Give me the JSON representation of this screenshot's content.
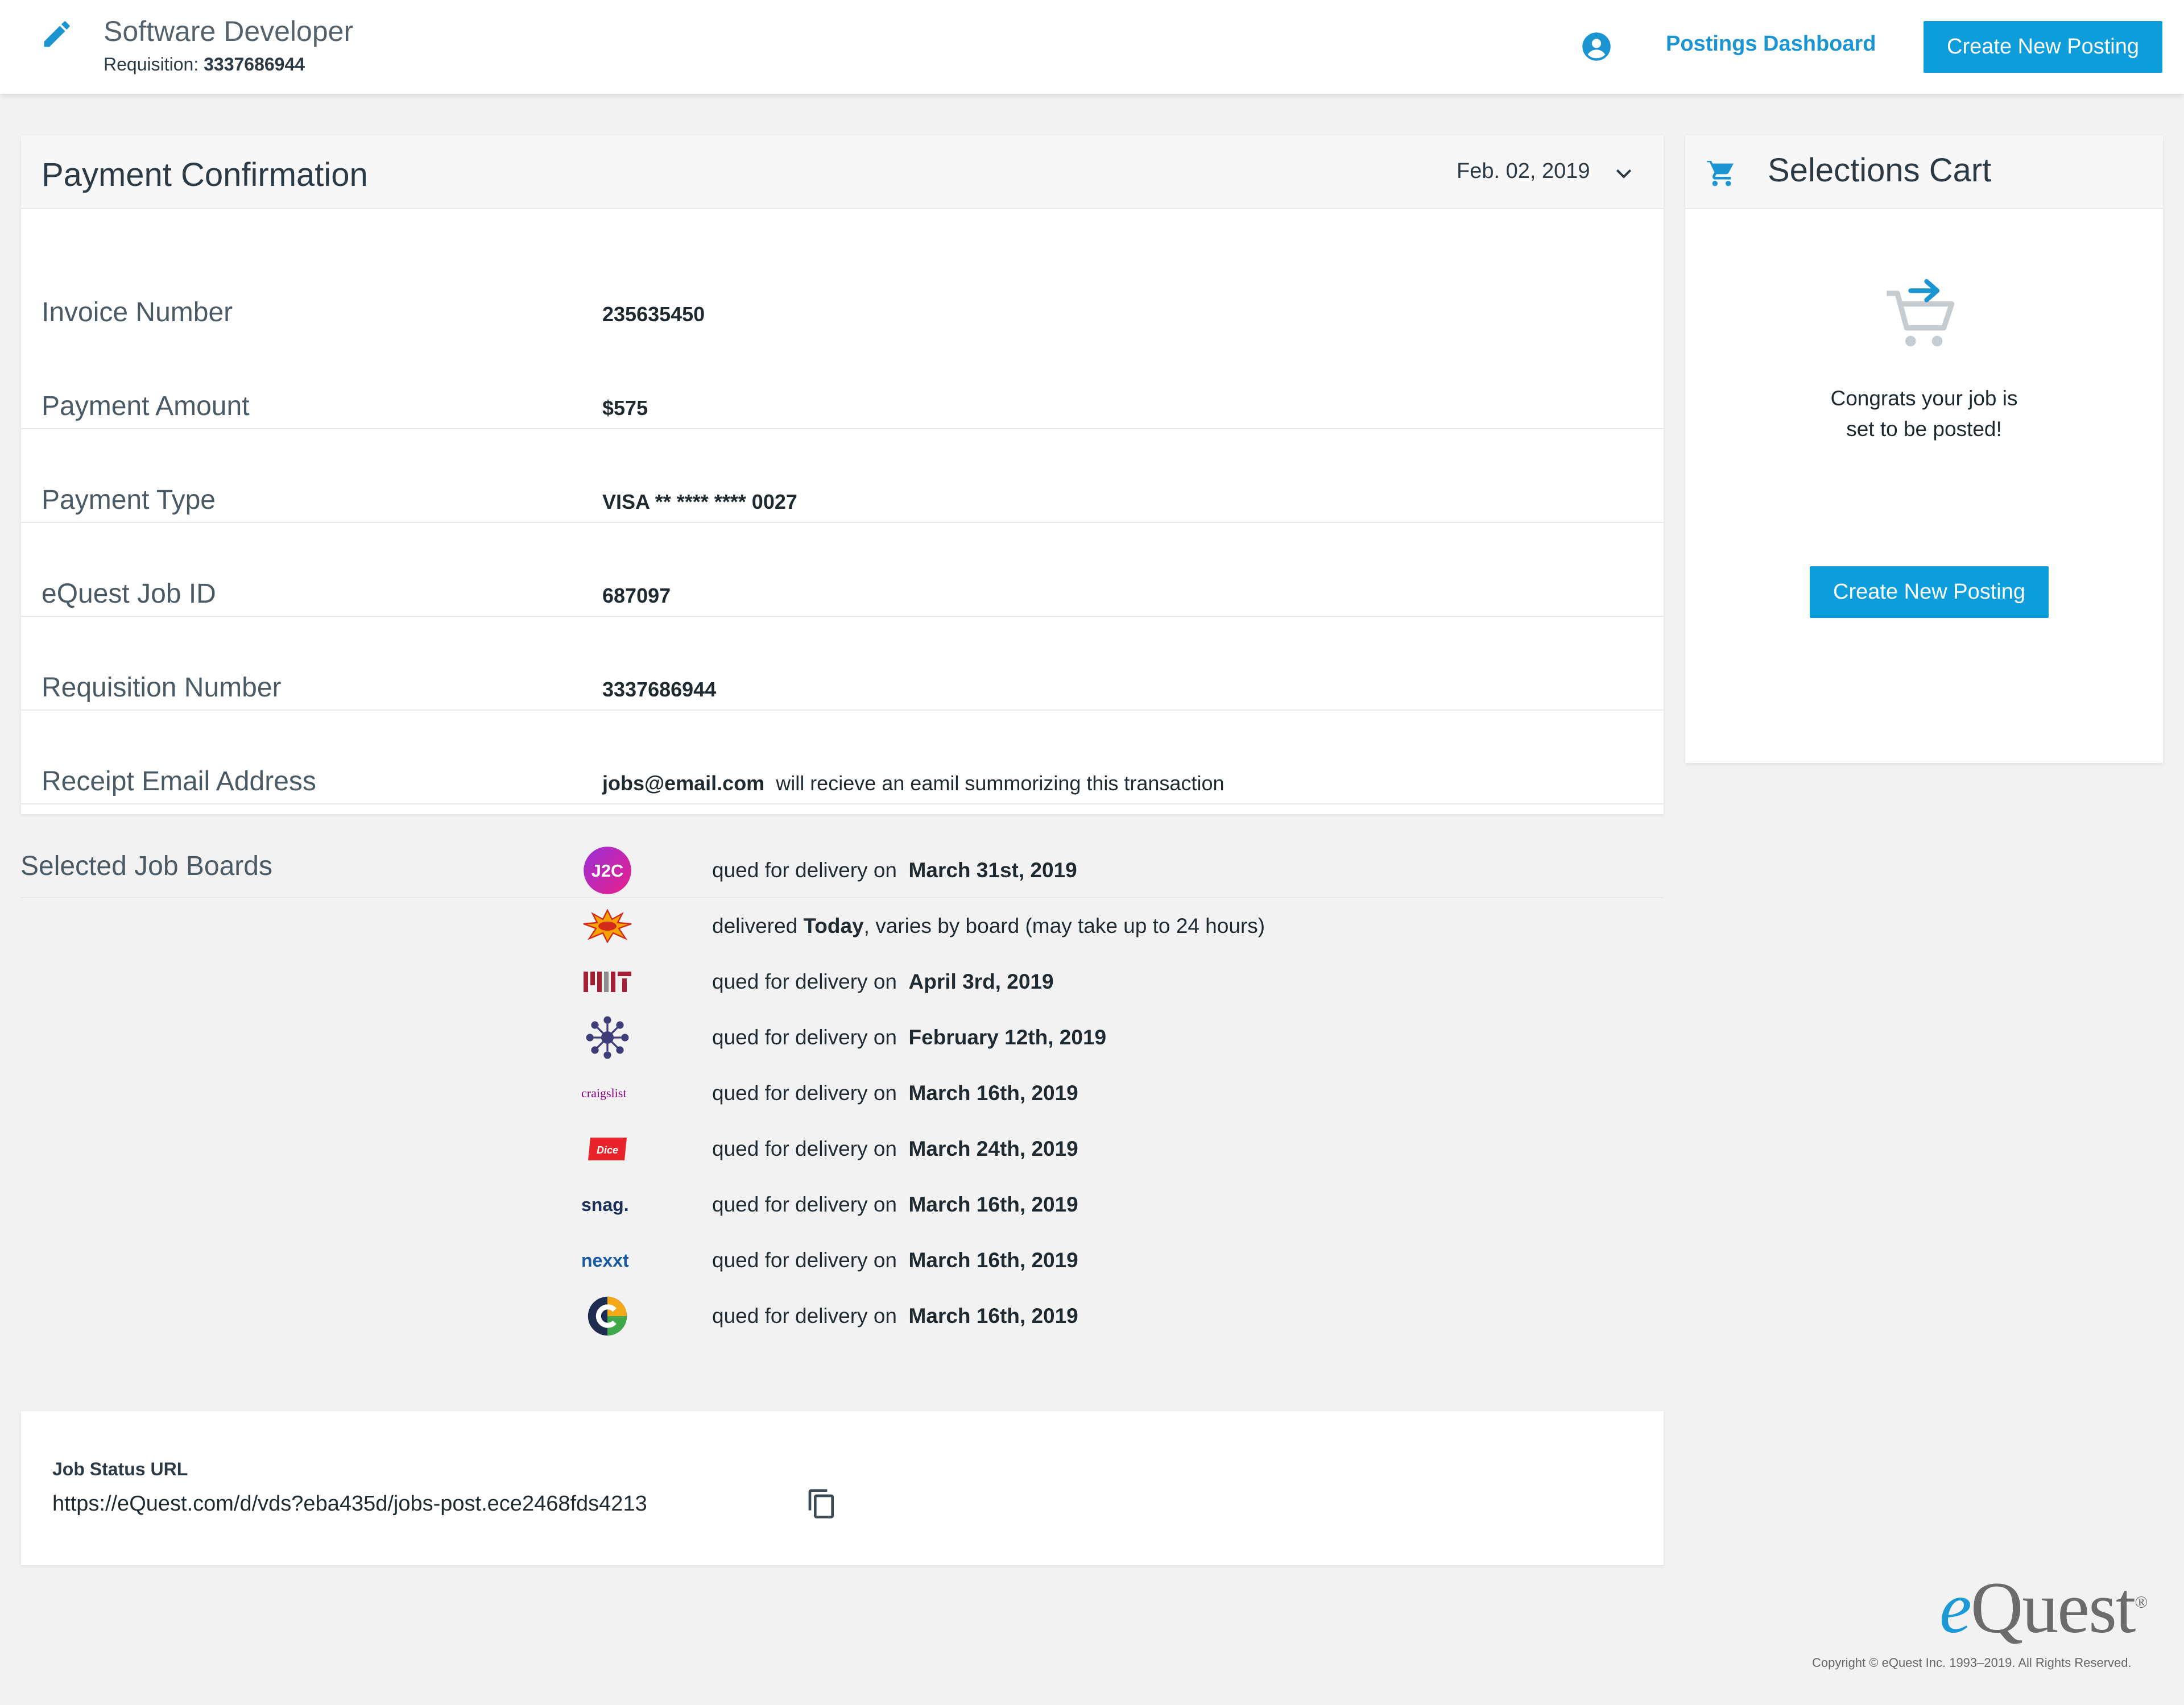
{
  "header": {
    "job_title": "Software Developer",
    "requisition_label": "Requisition:",
    "requisition_number": "3337686944",
    "dashboard_link": "Postings Dashboard",
    "create_button": "Create New Posting"
  },
  "payment": {
    "title": "Payment Confirmation",
    "date": "Feb.  02, 2019",
    "rows": [
      {
        "label": "Invoice Number",
        "value": "235635450"
      },
      {
        "label": "Payment Amount",
        "value": "$575"
      },
      {
        "label": "Payment Type",
        "value": "VISA  ** **** **** 0027"
      },
      {
        "label": "eQuest Job ID",
        "value": "687097"
      },
      {
        "label": "Requisition Number",
        "value": "3337686944"
      },
      {
        "label": "Receipt Email Address",
        "value": "jobs@email.com",
        "note": "will recieve an eamil summorizing this transaction"
      }
    ],
    "boards_label": "Selected Job Boards",
    "boards": [
      {
        "icon": "j2c-logo",
        "prefix": "qued for delivery on",
        "bold": "March 31st, 2019",
        "suffix": ""
      },
      {
        "icon": "burst-logo",
        "prefix": "delivered",
        "bold": "Today",
        "suffix": ", varies by board (may take up to 24 hours)"
      },
      {
        "icon": "mit-logo",
        "prefix": "qued for delivery on",
        "bold": "April 3rd, 2019",
        "suffix": ""
      },
      {
        "icon": "network-logo",
        "prefix": "qued for delivery on",
        "bold": "February 12th, 2019",
        "suffix": ""
      },
      {
        "icon": "craigslist-logo",
        "logo_text": "craigslist",
        "prefix": "qued for delivery on",
        "bold": "March 16th, 2019",
        "suffix": ""
      },
      {
        "icon": "dice-logo",
        "logo_text": "Dice",
        "prefix": "qued for delivery on",
        "bold": "March 24th, 2019",
        "suffix": ""
      },
      {
        "icon": "snag-logo",
        "logo_text": "snag.",
        "prefix": "qued for delivery on",
        "bold": "March 16th, 2019",
        "suffix": ""
      },
      {
        "icon": "nexxt-logo",
        "logo_text": "nexxt",
        "prefix": "qued for delivery on",
        "bold": "March 16th, 2019",
        "suffix": ""
      },
      {
        "icon": "circle-c-logo",
        "prefix": "qued for delivery on",
        "bold": "March 16th, 2019",
        "suffix": ""
      }
    ]
  },
  "cart": {
    "title": "Selections Cart",
    "message_line1": "Congrats your job is",
    "message_line2": "set to be posted!",
    "button": "Create New Posting"
  },
  "status_url": {
    "label": "Job Status URL",
    "value": "https://eQuest.com/d/vds?eba435d/jobs-post.ece2468fds4213"
  },
  "footer": {
    "brand_e": "e",
    "brand_rest": "Quest",
    "brand_mark": "®",
    "copyright": "Copyright © eQuest Inc. 1993–2019. All Rights Reserved."
  },
  "colors": {
    "accent": "#0d9ddb",
    "link": "#1b95d2"
  }
}
